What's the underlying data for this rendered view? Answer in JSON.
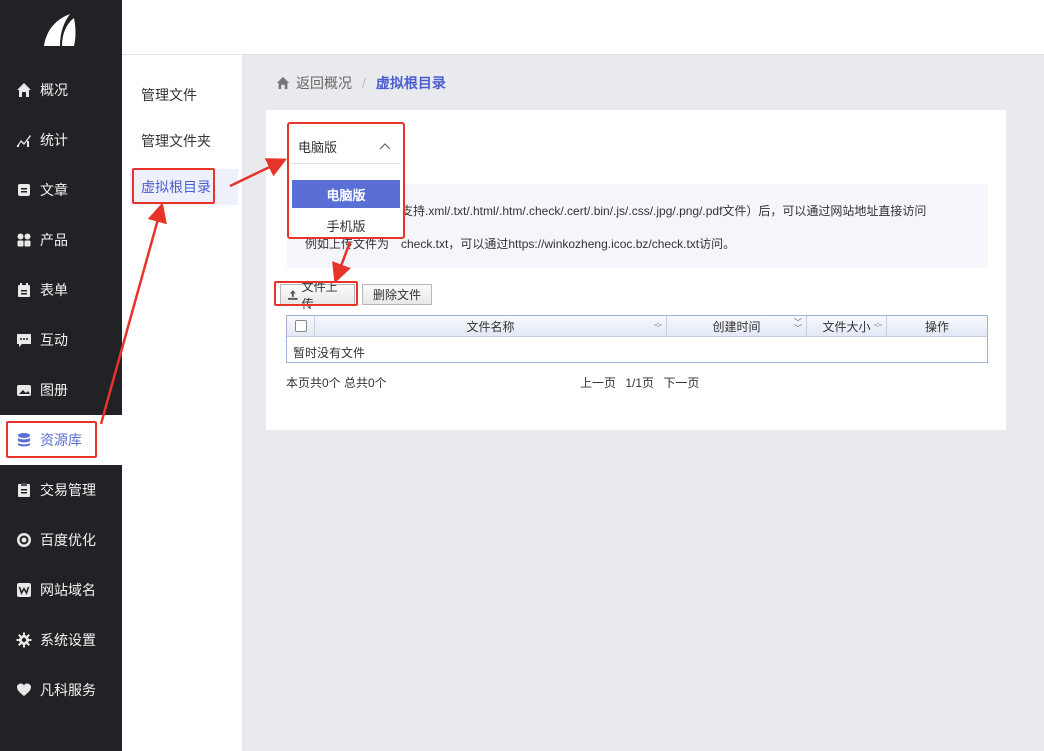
{
  "nav": {
    "items": [
      {
        "label": "概况",
        "icon": "home-icon"
      },
      {
        "label": "统计",
        "icon": "chart-icon"
      },
      {
        "label": "文章",
        "icon": "article-icon"
      },
      {
        "label": "产品",
        "icon": "grid-icon"
      },
      {
        "label": "表单",
        "icon": "form-icon"
      },
      {
        "label": "互动",
        "icon": "chat-icon"
      },
      {
        "label": "图册",
        "icon": "image-icon"
      },
      {
        "label": "资源库",
        "icon": "database-icon"
      },
      {
        "label": "交易管理",
        "icon": "clipboard-icon"
      },
      {
        "label": "百度优化",
        "icon": "target-icon"
      },
      {
        "label": "网站域名",
        "icon": "w-icon"
      },
      {
        "label": "系统设置",
        "icon": "gear-icon"
      },
      {
        "label": "凡科服务",
        "icon": "heart-icon"
      }
    ],
    "active_index": 7
  },
  "subnav": {
    "items": [
      "管理文件",
      "管理文件夹",
      "虚拟根目录"
    ],
    "active_index": 2
  },
  "breadcrumb": {
    "back": "返回概况",
    "separator": "/",
    "current": "虚拟根目录"
  },
  "select": {
    "value": "电脑版",
    "options": [
      "电脑版",
      "手机版"
    ]
  },
  "info": {
    "line1": "支持.xml/.txt/.html/.htm/.check/.cert/.bin/.js/.css/.jpg/.png/.pdf文件）后，可以通过网站地址直接访问",
    "line2_prefix": "例如上传文件为",
    "line2": "check.txt，可以通过https://winkozheng.icoc.bz/check.txt访问。"
  },
  "buttons": {
    "upload": "文件上传",
    "delete": "删除文件"
  },
  "table": {
    "columns": [
      "文件名称",
      "创建时间",
      "文件大小",
      "操作"
    ],
    "empty_text": "暂时没有文件"
  },
  "pager": {
    "summary": "本页共0个 总共0个",
    "prev": "上一页",
    "page": "1/1页",
    "next": "下一页"
  },
  "colors": {
    "accent": "#5a6fd6",
    "highlight": "#e8332b",
    "nav_bg": "#222226"
  }
}
